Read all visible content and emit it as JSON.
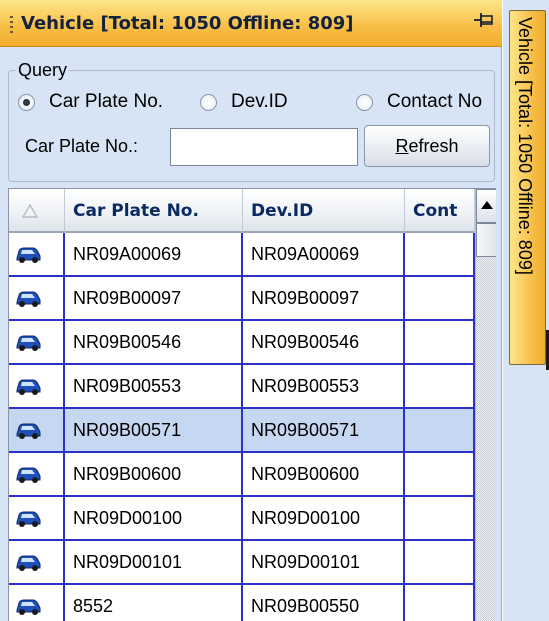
{
  "panel": {
    "title": "Vehicle [Total: 1050 Offline:  809]",
    "pin_icon": "pin-icon",
    "accent": "#f7c04a"
  },
  "query": {
    "group_label": "Query",
    "radios": [
      {
        "label": "Car Plate No.",
        "checked": true
      },
      {
        "label": "Dev.ID",
        "checked": false
      },
      {
        "label": "Contact No",
        "checked": false
      }
    ],
    "field_label": "Car Plate No.:",
    "field_value": "",
    "refresh_label_underlined": "R",
    "refresh_label_rest": "efresh"
  },
  "grid": {
    "columns": [
      "",
      "Car Plate No.",
      "Dev.ID",
      "Cont"
    ],
    "row_icon": "car-icon",
    "rows": [
      {
        "plate": "NR09A00069",
        "devid": "NR09A00069",
        "contact": ""
      },
      {
        "plate": "NR09B00097",
        "devid": "NR09B00097",
        "contact": ""
      },
      {
        "plate": "NR09B00546",
        "devid": "NR09B00546",
        "contact": ""
      },
      {
        "plate": "NR09B00553",
        "devid": "NR09B00553",
        "contact": ""
      },
      {
        "plate": "NR09B00571",
        "devid": "NR09B00571",
        "contact": "",
        "selected": true
      },
      {
        "plate": "NR09B00600",
        "devid": "NR09B00600",
        "contact": ""
      },
      {
        "plate": "NR09D00100",
        "devid": "NR09D00100",
        "contact": ""
      },
      {
        "plate": "NR09D00101",
        "devid": "NR09D00101",
        "contact": ""
      },
      {
        "plate": "8552",
        "devid": "NR09B00550",
        "contact": ""
      }
    ],
    "grid_line_color": "#2c32c8",
    "selected_row_color": "#c5d7f1"
  },
  "side_tab": {
    "label": "Vehicle [Total: 1050 Offline:  809]"
  }
}
